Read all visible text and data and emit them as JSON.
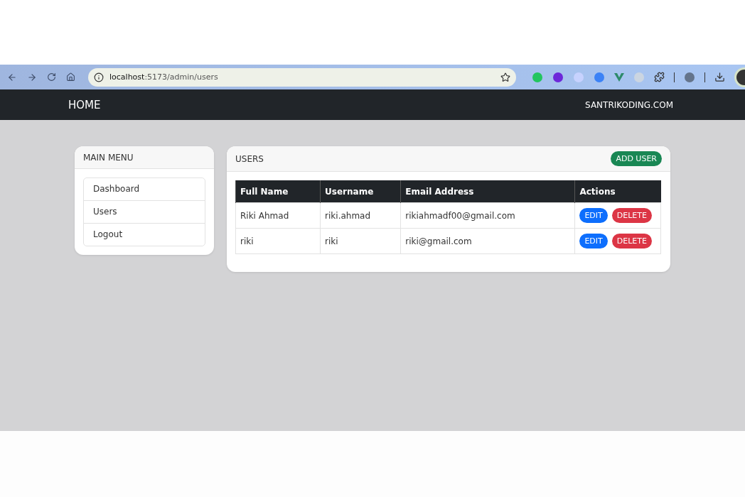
{
  "browser": {
    "url_host": "localhost",
    "url_path": ":5173/admin/users"
  },
  "navbar": {
    "brand": "HOME",
    "right_link": "SANTRIKODING.COM"
  },
  "sidebar": {
    "title": "MAIN MENU",
    "items": [
      {
        "label": "Dashboard"
      },
      {
        "label": "Users"
      },
      {
        "label": "Logout"
      }
    ]
  },
  "users_card": {
    "title": "USERS",
    "add_button": "ADD USER",
    "table": {
      "columns": [
        "Full Name",
        "Username",
        "Email Address",
        "Actions"
      ],
      "rows": [
        {
          "full_name": "Riki Ahmad",
          "username": "riki.ahmad",
          "email": "rikiahmadf00@gmail.com",
          "edit": "EDIT",
          "delete": "DELETE"
        },
        {
          "full_name": "riki",
          "username": "riki",
          "email": "riki@gmail.com",
          "edit": "EDIT",
          "delete": "DELETE"
        }
      ]
    }
  }
}
